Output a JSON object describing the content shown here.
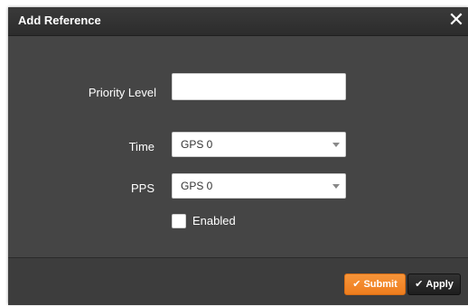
{
  "dialog": {
    "title": "Add Reference",
    "close_glyph": "✕"
  },
  "form": {
    "priority": {
      "label": "Priority Level",
      "value": "",
      "placeholder": ""
    },
    "time": {
      "label": "Time",
      "selected": "GPS 0"
    },
    "pps": {
      "label": "PPS",
      "selected": "GPS 0"
    },
    "enabled": {
      "label": "Enabled",
      "checked": false
    }
  },
  "footer": {
    "submit_label": "Submit",
    "apply_label": "Apply",
    "check_glyph": "✔"
  },
  "colors": {
    "submit": "#f28a2b",
    "apply": "#2a2a2a",
    "dialog_body": "#454545",
    "header": "#333333"
  },
  "icons": {
    "close": "close-icon",
    "dropdown": "chevron-down-icon",
    "submit": "check-icon",
    "apply": "check-icon"
  }
}
